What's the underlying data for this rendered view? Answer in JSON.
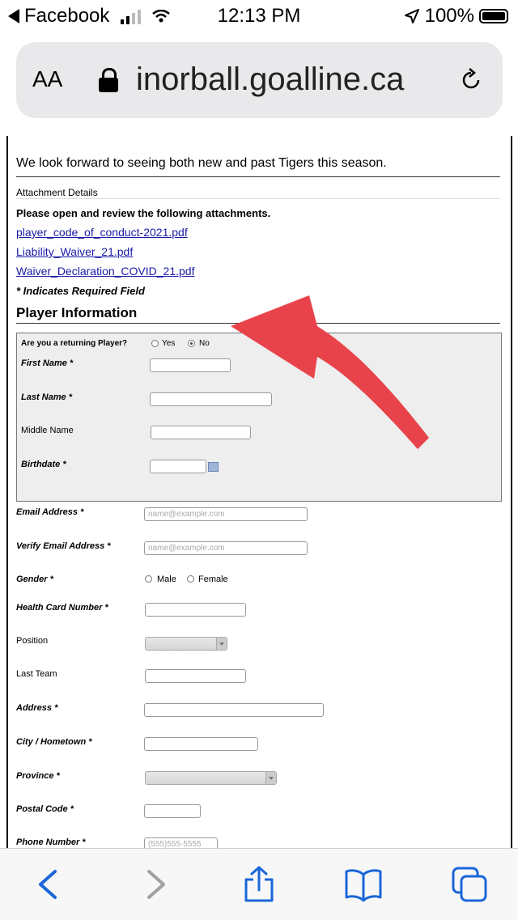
{
  "status_bar": {
    "back_app": "Facebook",
    "time": "12:13 PM",
    "battery": "100%"
  },
  "address_bar": {
    "text_size": "AA",
    "url": "inorball.goalline.ca"
  },
  "page": {
    "intro": "We look forward to seeing both new and past Tigers this season.",
    "attachment_heading": "Attachment Details",
    "attachment_instruction": "Please open and review the following attachments.",
    "attachments": [
      "player_code_of_conduct-2021.pdf",
      "Liability_Waiver_21.pdf",
      "Waiver_Declaration_COVID_21.pdf"
    ],
    "required_note": "* Indicates Required Field",
    "section_title": "Player Information",
    "returning": {
      "question": "Are you a returning Player?",
      "yes": "Yes",
      "no": "No",
      "selected": "No"
    },
    "fields": {
      "first_name": "First Name *",
      "last_name": "Last Name *",
      "middle_name": "Middle Name",
      "birthdate": "Birthdate *",
      "email": "Email Address *",
      "email_placeholder": "name@example.com",
      "verify_email": "Verify Email Address *",
      "verify_placeholder": "name@example.com",
      "gender": "Gender *",
      "gender_male": "Male",
      "gender_female": "Female",
      "health_card": "Health Card Number *",
      "position": "Position",
      "last_team": "Last Team",
      "address": "Address *",
      "city": "City / Hometown *",
      "province": "Province *",
      "postal": "Postal Code *",
      "phone": "Phone Number *",
      "phone_placeholder": "(555)555-5555"
    }
  },
  "colors": {
    "arrow": "#e8434b",
    "link": "#1a1aa6",
    "ios_blue": "#1a66d9"
  }
}
